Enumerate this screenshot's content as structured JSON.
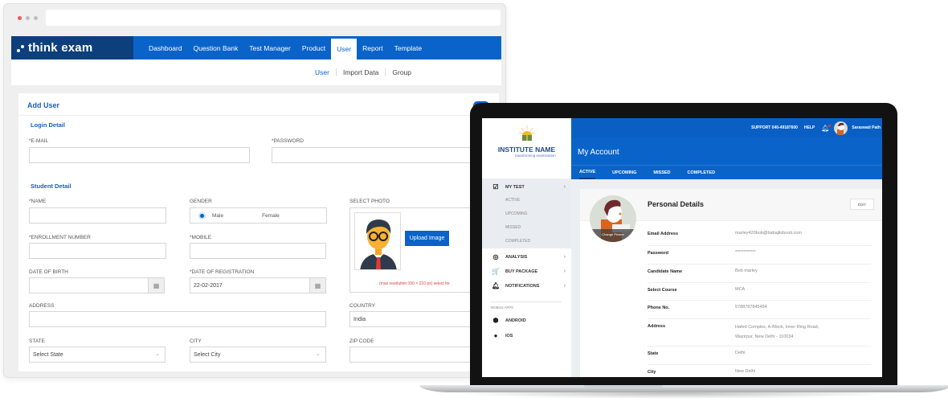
{
  "browser": {
    "brand": "think exam",
    "nav": [
      "Dashboard",
      "Question Bank",
      "Test Manager",
      "Product",
      "User",
      "Report",
      "Template"
    ],
    "nav_active": "User",
    "subnav": [
      "User",
      "Import Data",
      "Group"
    ],
    "form": {
      "title": "Add User",
      "login_section": "Login Detail",
      "email_label": "*E-MAIL",
      "password_label": "*PASSWORD",
      "student_section": "Student Detail",
      "name_label": "*NAME",
      "gender_label": "GENDER",
      "gender_options": [
        "Male",
        "Female"
      ],
      "gender_selected": "Male",
      "photo_label": "SELECT PHOTO",
      "upload_label": "Upload Image",
      "photo_note": "(max resolution 150 × 210 px) select for",
      "enrollment_label": "*ENROLLMENT NUMBER",
      "mobile_label": "*MOBILE",
      "dob_label": "DATE OF BIRTH",
      "dor_label": "*DATE OF REGISTRATION",
      "dor_value": "22-02-2017",
      "address_label": "ADDRESS",
      "country_label": "COUNTRY",
      "country_value": "India",
      "state_label": "STATE",
      "state_placeholder": "Select State",
      "city_label": "CITY",
      "city_placeholder": "Select City",
      "zip_label": "ZIP CODE"
    }
  },
  "laptop": {
    "institute_name": "INSTITUTE NAME",
    "institute_tagline": "transforming examination",
    "topbar": {
      "support": "SUPPORT  040-49187600",
      "help": "HELP",
      "user_name": "Saraswati Path"
    },
    "page_title": "My Account",
    "tabs": [
      "ACTIVE",
      "UPCOMING",
      "MISSED",
      "COMPLETED"
    ],
    "tab_active": "ACTIVE",
    "menu": {
      "my_test": "MY TEST",
      "my_test_sub": [
        "ACTIVE",
        "UPCOMING",
        "MISSED",
        "COMPLETED"
      ],
      "analysis": "ANALYSIS",
      "buy_package": "BUY PACKAGE",
      "notifications": "NOTIFICATIONS",
      "mobile_caption": "MOBILE APPS",
      "android": "ANDROID",
      "ios": "IOS"
    },
    "personal": {
      "title": "Personal Details",
      "edit_label": "EDIT",
      "change_picture": "Change Picture",
      "rows": [
        {
          "key": "Email Address",
          "value": "marley420bob@babajikibooti.com"
        },
        {
          "key": "Password",
          "value": "************"
        },
        {
          "key": "Candidate Name",
          "value": "Bob marley"
        },
        {
          "key": "Select Course",
          "value": "MCA"
        },
        {
          "key": "Phone No.",
          "value": "5788787845454"
        },
        {
          "key": "Address",
          "value": "Hafed Complex, A-Block, Inner Ring Road,",
          "value2": "Wazirpur, New Delhi - 110034"
        },
        {
          "key": "State",
          "value": "Delhi"
        },
        {
          "key": "City",
          "value": "New Delhi"
        }
      ]
    }
  },
  "colors": {
    "primary": "#0a63c9",
    "brand_dark": "#0d3f7c",
    "note_red": "#e23a3a"
  }
}
